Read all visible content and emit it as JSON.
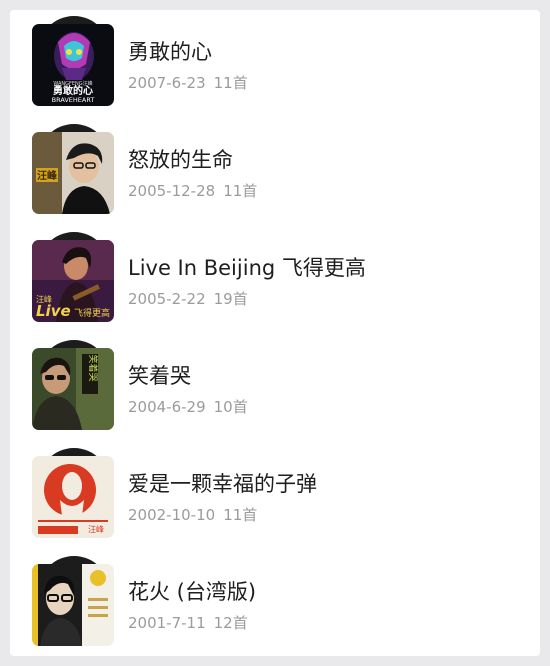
{
  "albums": [
    {
      "title": "勇敢的心",
      "date": "2007-6-23",
      "tracks": "11首",
      "cover_icon": "album-cover-brave-heart"
    },
    {
      "title": "怒放的生命",
      "date": "2005-12-28",
      "tracks": "11首",
      "cover_icon": "album-cover-portrait"
    },
    {
      "title": "Live In Beijing 飞得更高",
      "date": "2005-2-22",
      "tracks": "19首",
      "cover_icon": "album-cover-live"
    },
    {
      "title": "笑着哭",
      "date": "2004-6-29",
      "tracks": "10首",
      "cover_icon": "album-cover-portrait"
    },
    {
      "title": "爱是一颗幸福的子弹",
      "date": "2002-10-10",
      "tracks": "11首",
      "cover_icon": "album-cover-red-silhouette"
    },
    {
      "title": "花火 (台湾版)",
      "date": "2001-7-11",
      "tracks": "12首",
      "cover_icon": "album-cover-portrait"
    }
  ],
  "cover_logos": {
    "brave_heart_cn": "勇敢的心",
    "brave_heart_en": "BRAVEHEART",
    "brave_heart_artist": "WANGFENG汪峰",
    "life_artist": "汪峰",
    "live_text": "Live",
    "live_artist": "汪峰",
    "live_subtitle": "飞得更高",
    "xiao_title": "笑着哭",
    "bullet_artist": "汪峰"
  },
  "colors": {
    "page_background": "#e9e9ec",
    "panel_background": "#ffffff",
    "title_text": "#1e1e1e",
    "meta_text": "#9b9b9b",
    "disc": "#1c1c1c"
  }
}
